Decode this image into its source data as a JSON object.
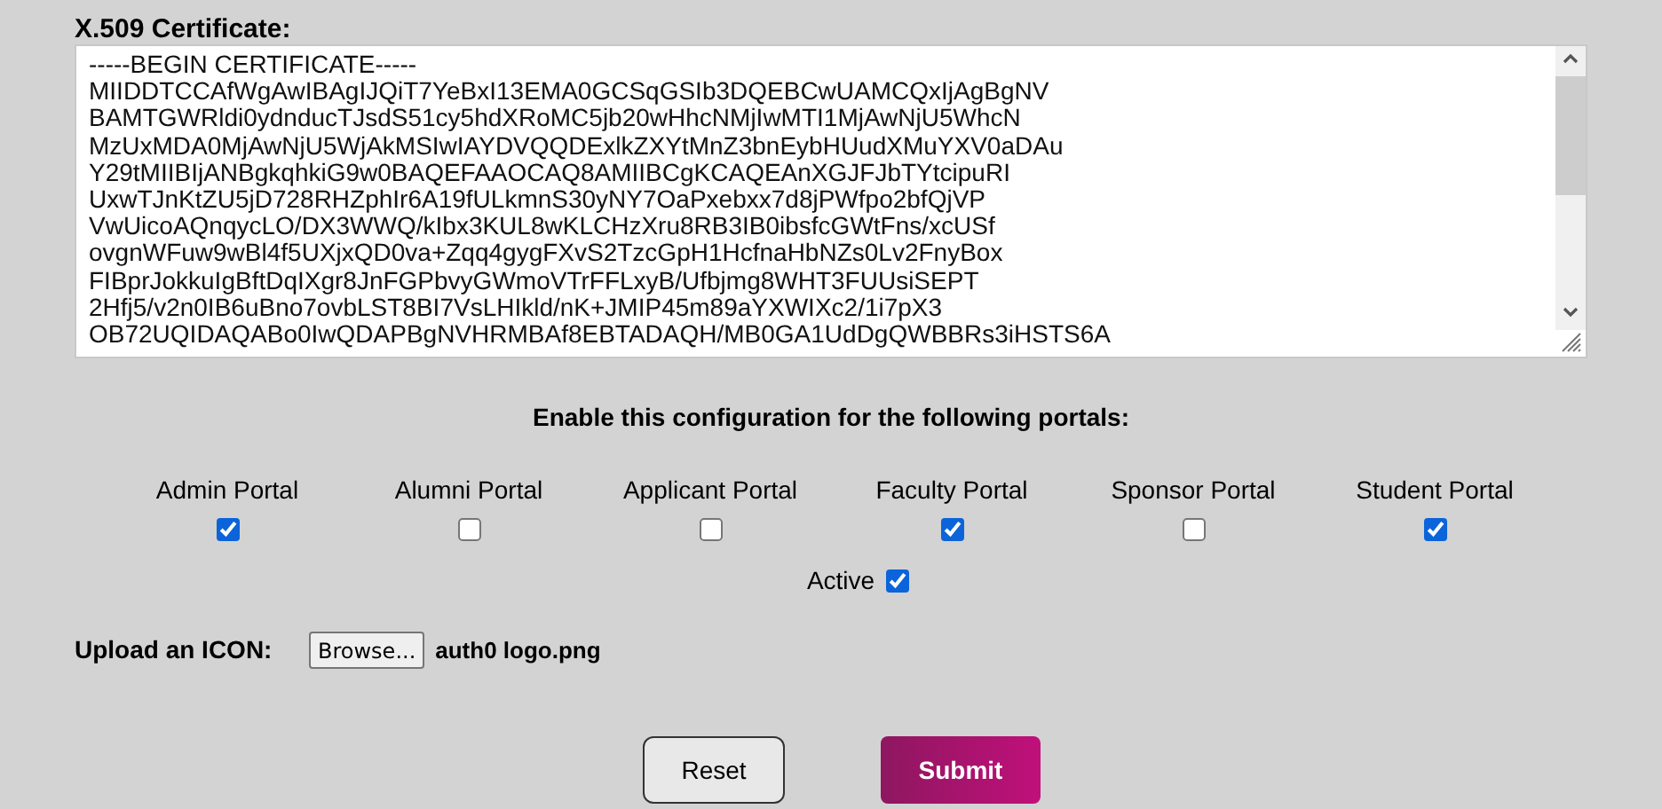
{
  "certificate": {
    "label": "X.509 Certificate:",
    "value": "-----BEGIN CERTIFICATE-----\nMIIDDTCCAfWgAwIBAgIJQiT7YeBxI13EMA0GCSqGSIb3DQEBCwUAMCQxIjAgBgNV\nBAMTGWRldi0ydnducTJsdS51cy5hdXRoMC5jb20wHhcNMjIwMTI1MjAwNjU5WhcN\nMzUxMDA0MjAwNjU5WjAkMSIwIAYDVQQDExlkZXYtMnZ3bnEybHUudXMuYXV0aDAu\nY29tMIIBIjANBgkqhkiG9w0BAQEFAAOCAQ8AMIIBCgKCAQEAnXGJFJbTYtcipuRI\nUxwTJnKtZU5jD728RHZphIr6A19fULkmnS30yNY7OaPxebxx7d8jPWfpo2bfQjVP\nVwUicoAQnqycLO/DX3WWQ/kIbx3KUL8wKLCHzXru8RB3IB0ibsfcGWtFns/xcUSf\novgnWFuw9wBl4f5UXjxQD0va+Zqq4gygFXvS2TzcGpH1HcfnaHbNZs0Lv2FnyBox\nFIBprJokkuIgBftDqIXgr8JnFGPbvyGWmoVTrFFLxyB/Ufbjmg8WHT3FUUsiSEPT\n2Hfj5/v2n0IB6uBno7ovbLST8BI7VsLHIkld/nK+JMIP45m89aYXWIXc2/1i7pX3\nOB72UQIDAQABo0IwQDAPBgNVHRMBAf8EBTADAQH/MB0GA1UdDgQWBBRs3iHSTS6A"
  },
  "portals": {
    "heading": "Enable this configuration for the following portals:",
    "items": [
      {
        "label": "Admin Portal",
        "checked": true
      },
      {
        "label": "Alumni Portal",
        "checked": false
      },
      {
        "label": "Applicant Portal",
        "checked": false
      },
      {
        "label": "Faculty Portal",
        "checked": true
      },
      {
        "label": "Sponsor Portal",
        "checked": false
      },
      {
        "label": "Student Portal",
        "checked": true
      }
    ]
  },
  "active": {
    "label": "Active",
    "checked": true
  },
  "upload": {
    "label": "Upload an ICON:",
    "button": "Browse...",
    "filename": "auth0 logo.png"
  },
  "buttons": [
    {
      "label": "Reset",
      "kind": "secondary"
    },
    {
      "label": "Submit",
      "kind": "primary"
    }
  ]
}
